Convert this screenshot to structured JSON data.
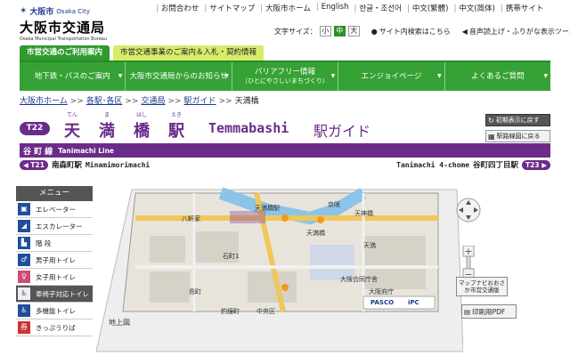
{
  "logo": {
    "brand": "大阪市",
    "brand_en": "Osaka City",
    "name": "大阪市交通局",
    "name_en": "Osaka Municipal Transportation Bureau"
  },
  "toplinks": [
    "お問合わせ",
    "サイトマップ",
    "大阪市ホーム",
    "English",
    "한글・조선어",
    "中文(繁體)",
    "中文(简体)",
    "携帯サイト"
  ],
  "utility": {
    "font_label": "文字サイズ：",
    "font_sizes": [
      "小",
      "中",
      "大"
    ],
    "search_label": "サイト内検索はこちら",
    "voice_label": "音声読上げ・ふりがな表示ツール"
  },
  "site_tabs": [
    "市営交通のご利用案内",
    "市営交通事業のご案内＆入札・契約情報"
  ],
  "gnav": [
    {
      "label": "地下鉄・バスのご案内",
      "sub": ""
    },
    {
      "label": "大阪市交通局からのお知らせ",
      "sub": ""
    },
    {
      "label": "バリアフリー情報",
      "sub": "（ひとにやさしいまちづくり）"
    },
    {
      "label": "エンジョイページ",
      "sub": ""
    },
    {
      "label": "よくあるご質問",
      "sub": ""
    }
  ],
  "breadcrumb": [
    "大阪市ホーム",
    "各駅･各区",
    "交通局",
    "駅ガイド",
    "天満橋"
  ],
  "breadcrumb_sep": ">>",
  "station": {
    "code": "T22",
    "kanji": [
      {
        "kj": "天",
        "rb": "てん"
      },
      {
        "kj": "満",
        "rb": "ま"
      },
      {
        "kj": "橋",
        "rb": "はし"
      },
      {
        "kj": "駅",
        "rb": "えき"
      }
    ],
    "name_en": "Temmabashi",
    "guide": "駅ガイド"
  },
  "right_buttons": [
    "初期表示に戻す",
    "駅路線図に戻る"
  ],
  "line": {
    "name": "谷 町 線",
    "name_en": "Tanimachi Line"
  },
  "adjacent": {
    "prev": {
      "code": "T21",
      "name": "南森町駅",
      "name_en": "Minamimorimachi"
    },
    "next": {
      "code": "T23",
      "name": "谷町四丁目駅",
      "name_en": "Tanimachi 4-chome"
    }
  },
  "menu": {
    "title": "メニュー",
    "items": [
      {
        "label": "エレベーター",
        "icon": "elevator-icon",
        "glyph": "▣"
      },
      {
        "label": "エスカレーター",
        "icon": "escalator-icon",
        "glyph": "◢"
      },
      {
        "label": "階 段",
        "icon": "stairs-icon",
        "glyph": "▙"
      },
      {
        "label": "男子用トイレ",
        "icon": "mens-toilet-icon",
        "glyph": "♂"
      },
      {
        "label": "女子用トイレ",
        "icon": "womens-toilet-icon",
        "glyph": "♀"
      },
      {
        "label": "車椅子対応トイレ",
        "icon": "wheelchair-toilet-icon",
        "glyph": "♿"
      },
      {
        "label": "多機能トイレ",
        "icon": "multipurpose-toilet-icon",
        "glyph": "♿"
      },
      {
        "label": "きっぷうりば",
        "icon": "ticket-icon",
        "glyph": "券"
      }
    ]
  },
  "map": {
    "label": "地上図",
    "places": [
      "天満橋駅",
      "天満橋",
      "天神橋",
      "八軒家",
      "石町1",
      "島町",
      "釣鐘町",
      "天満",
      "大阪合同庁舎",
      "大阪府庁",
      "中央区",
      "京阪",
      "PASCO",
      "iPC"
    ]
  },
  "side_links": {
    "osaka": "マップナビおおさか市営交通版",
    "pdf": "印刷用PDF"
  },
  "colors": {
    "green": "#36a236",
    "purple": "#6b2b8a"
  }
}
